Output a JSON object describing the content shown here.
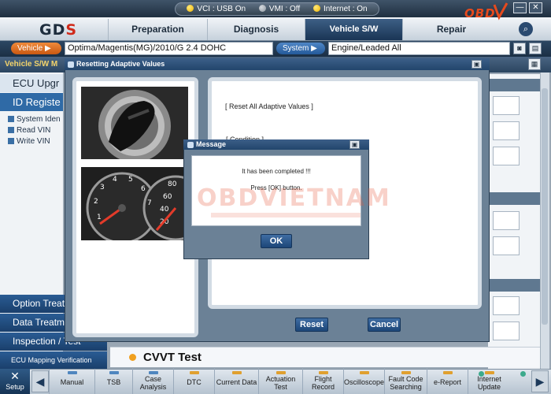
{
  "status": {
    "vci": "VCI : USB On",
    "vmi": "VMI : Off",
    "internet": "Internet : On",
    "on_color": "#f0b400",
    "off_color": "#8d969f"
  },
  "logos": {
    "brand": "OBDVIETNAM",
    "gds_main": "GD",
    "gds_tail": "S",
    "watermark": "OBDVIETNAM"
  },
  "nav": {
    "tabs": [
      "Preparation",
      "Diagnosis",
      "Vehicle S/W Management",
      "Repair"
    ],
    "active": "Vehicle S/W Management"
  },
  "vehicle": {
    "vehicle_label": "Vehicle",
    "model": "Optima/Magentis(MG)/2010/G 2.4 DOHC",
    "system_label": "System",
    "engine": "Engine/Leaded All"
  },
  "sidebar": {
    "title": "Vehicle S/W M",
    "ecu_upgrade": "ECU Upgr",
    "id_register": "ID Registe",
    "items": [
      "System Iden",
      "Read VIN",
      "Write VIN"
    ],
    "lower": [
      "Option Treatm",
      "Data Treatm",
      "Inspection / Test",
      "ECU Mapping Verification"
    ]
  },
  "cvvt": {
    "label": "CVVT Test"
  },
  "dialog": {
    "title": "Resetting Adaptive Values",
    "reset_all": "[ Reset All Adaptive Values ]",
    "condition": "[ Condition ]",
    "reset_button": "Reset",
    "cancel_button": "Cancel"
  },
  "message": {
    "title": "Message",
    "line1": "It has been completed !!!",
    "line2": "Press [OK] button.",
    "ok_button": "OK"
  },
  "toolbar": {
    "setup": "Setup",
    "buttons": [
      {
        "label": "Manual",
        "color": "#4f86bf"
      },
      {
        "label": "TSB",
        "color": "#4f86bf"
      },
      {
        "label": "Case Analysis",
        "color": "#4f86bf"
      },
      {
        "label": "DTC",
        "color": "#e0a030"
      },
      {
        "label": "Current Data",
        "color": "#e0a030"
      },
      {
        "label": "Actuation Test",
        "color": "#e0a030"
      },
      {
        "label": "Flight Record",
        "color": "#e0a030"
      },
      {
        "label": "Oscilloscope",
        "color": "#e0a030"
      },
      {
        "label": "Fault Code Searching",
        "color": "#e0a030"
      },
      {
        "label": "e-Report",
        "color": "#e0a030"
      },
      {
        "label": "Internet Update",
        "color": "#e0a030"
      }
    ]
  },
  "gauge_numbers": [
    "1",
    "2",
    "3",
    "4",
    "5",
    "6",
    "7",
    "20",
    "40",
    "60",
    "80"
  ]
}
